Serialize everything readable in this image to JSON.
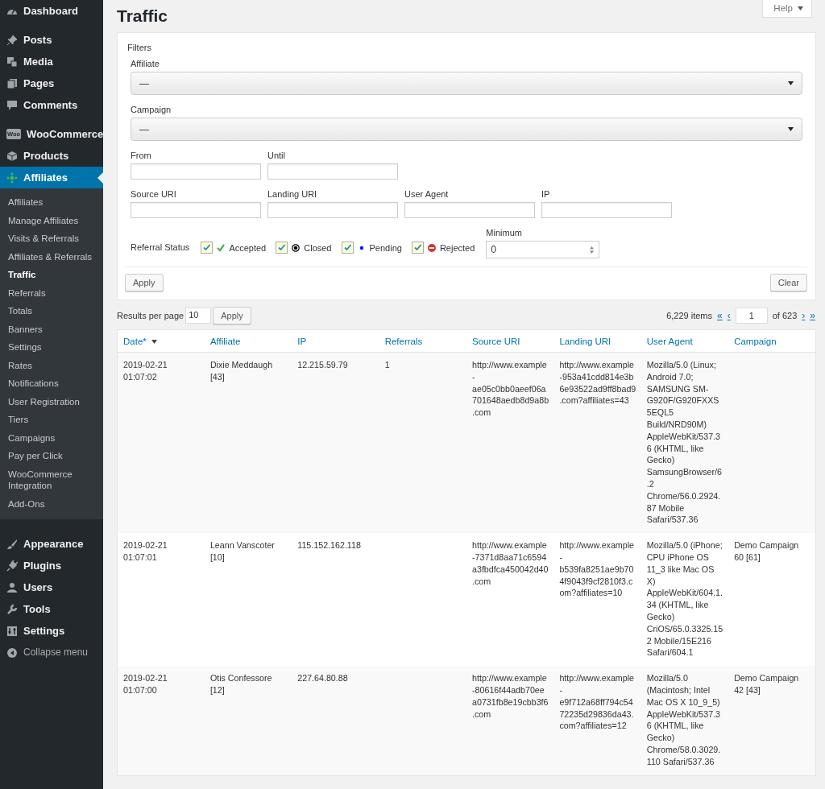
{
  "sidebar": {
    "sections": [
      {
        "items": [
          {
            "label": "Dashboard",
            "kind": "gauge",
            "selected": false
          }
        ]
      },
      {
        "items": [
          {
            "label": "Posts",
            "kind": "pin",
            "selected": false
          },
          {
            "label": "Media",
            "kind": "media",
            "selected": false
          },
          {
            "label": "Pages",
            "kind": "pages",
            "selected": false
          },
          {
            "label": "Comments",
            "kind": "comment",
            "selected": false
          }
        ]
      },
      {
        "items": [
          {
            "label": "WooCommerce",
            "kind": "woo",
            "icon_text": "Woo",
            "selected": false
          },
          {
            "label": "Products",
            "kind": "box",
            "selected": false
          },
          {
            "label": "Affiliates",
            "kind": "network",
            "selected": true,
            "children": [
              {
                "label": "Affiliates",
                "selected": false
              },
              {
                "label": "Manage Affiliates",
                "selected": false
              },
              {
                "label": "Visits & Referrals",
                "selected": false
              },
              {
                "label": "Affiliates & Referrals",
                "selected": false
              },
              {
                "label": "Traffic",
                "selected": true
              },
              {
                "label": "Referrals",
                "selected": false
              },
              {
                "label": "Totals",
                "selected": false
              },
              {
                "label": "Banners",
                "selected": false
              },
              {
                "label": "Settings",
                "selected": false
              },
              {
                "label": "Rates",
                "selected": false
              },
              {
                "label": "Notifications",
                "selected": false
              },
              {
                "label": "User Registration",
                "selected": false
              },
              {
                "label": "Tiers",
                "selected": false
              },
              {
                "label": "Campaigns",
                "selected": false
              },
              {
                "label": "Pay per Click",
                "selected": false
              },
              {
                "label": "WooCommerce Integration",
                "selected": false
              },
              {
                "label": "Add-Ons",
                "selected": false
              }
            ]
          }
        ]
      },
      {
        "items": [
          {
            "label": "Appearance",
            "kind": "brush",
            "selected": false
          },
          {
            "label": "Plugins",
            "kind": "plug",
            "selected": false
          },
          {
            "label": "Users",
            "kind": "user",
            "selected": false
          },
          {
            "label": "Tools",
            "kind": "wrench",
            "selected": false
          },
          {
            "label": "Settings",
            "kind": "sliders",
            "selected": false
          },
          {
            "label": "Collapse menu",
            "kind": "collapse",
            "selected": false
          }
        ]
      }
    ]
  },
  "page_title": "Traffic",
  "help_button": "Help",
  "filters": {
    "title": "Filters",
    "selects": [
      {
        "label": "Affiliate",
        "value": "—"
      },
      {
        "label": "Campaign",
        "value": "—"
      }
    ],
    "field_rows": [
      [
        {
          "label": "From"
        },
        {
          "label": "Until"
        }
      ],
      [
        {
          "label": "Source URI"
        },
        {
          "label": "Landing URI"
        },
        {
          "label": "User Agent"
        },
        {
          "label": "IP"
        }
      ]
    ],
    "status_label": "Referral Status",
    "statuses": [
      {
        "label": "Accepted",
        "kind": "accepted",
        "checked": true
      },
      {
        "label": "Closed",
        "kind": "closed",
        "checked": true
      },
      {
        "label": "Pending",
        "kind": "pending",
        "checked": true
      },
      {
        "label": "Rejected",
        "kind": "rejected",
        "checked": true
      }
    ],
    "minimum": {
      "label": "Minimum",
      "value": "0"
    },
    "apply_button": "Apply",
    "clear_button": "Clear"
  },
  "results_per_page": {
    "label": "Results per page",
    "value": "10",
    "button": "Apply"
  },
  "pagination": {
    "items": "6,229 items",
    "first": "«",
    "prev": "‹",
    "page": "1",
    "of": "of 623",
    "next": "›",
    "last": "»"
  },
  "table": {
    "columns": [
      {
        "label": "Date*",
        "sorted": true
      },
      {
        "label": "Affiliate",
        "sorted": false
      },
      {
        "label": "IP",
        "sorted": false
      },
      {
        "label": "Referrals",
        "sorted": false
      },
      {
        "label": "Source URI",
        "sorted": false
      },
      {
        "label": "Landing URI",
        "sorted": false
      },
      {
        "label": "User Agent",
        "sorted": false
      },
      {
        "label": "Campaign",
        "sorted": false
      }
    ],
    "rows": [
      [
        "2019-02-21 01:07:02",
        "Dixie Meddaugh [43]",
        "12.215.59.79",
        "1",
        "http://www.example-ae05c0bb0aeef06a701648aedb8d9a8b.com",
        "http://www.example-953a41cdd814e3b6e93522ad9ff8bad9.com?affiliates=43",
        "Mozilla/5.0 (Linux; Android 7.0; SAMSUNG SM-G920F/G920FXXS5EQL5 Build/NRD90M) AppleWebKit/537.36 (KHTML, like Gecko) SamsungBrowser/6.2 Chrome/56.0.2924.87 Mobile Safari/537.36",
        ""
      ],
      [
        "2019-02-21 01:07:01",
        "Leann Vanscoter [10]",
        "115.152.162.118",
        "",
        "http://www.example-7371d8aa71c6594a3fbdfca450042d40.com",
        "http://www.example-b539fa8251ae9b704f9043f9cf2810f3.com?affiliates=10",
        "Mozilla/5.0 (iPhone; CPU iPhone OS 11_3 like Mac OS X) AppleWebKit/604.1.34 (KHTML, like Gecko) CriOS/65.0.3325.152 Mobile/15E216 Safari/604.1",
        "Demo Campaign 60 [61]"
      ],
      [
        "2019-02-21 01:07:00",
        "Otis Confessore [12]",
        "227.64.80.88",
        "",
        "http://www.example-80616f44adb70eea0731fb8e19cbb3f6.com",
        "http://www.example-e9f712a68ff794c5472235d29836da43.com?affiliates=12",
        "Mozilla/5.0 (Macintosh; Intel Mac OS X 10_9_5) AppleWebKit/537.36 (KHTML, like Gecko) Chrome/58.0.3029.110 Safari/537.36",
        "Demo Campaign 42 [43]"
      ]
    ]
  }
}
